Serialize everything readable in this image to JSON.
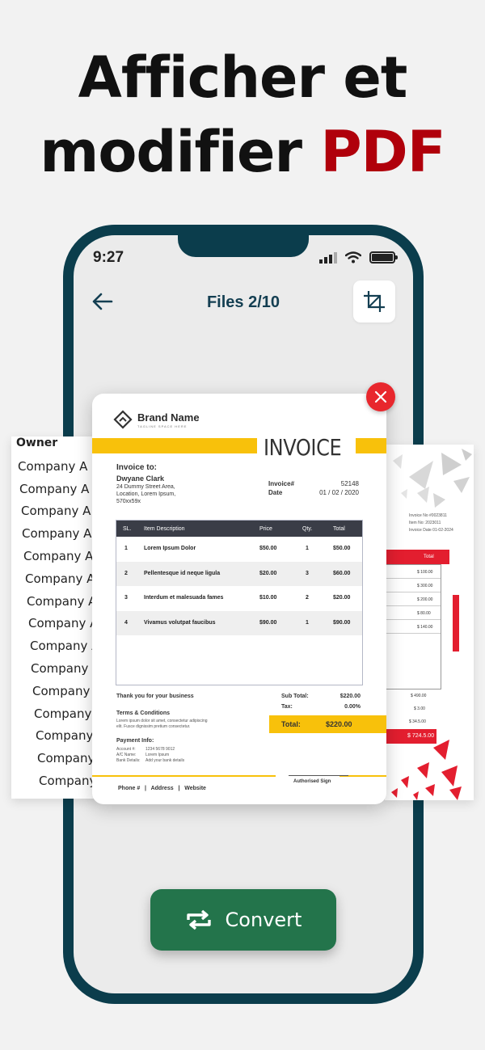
{
  "headline": {
    "line1": "Afficher et",
    "line2_prefix": "modifier ",
    "line2_accent": "PDF"
  },
  "status_bar": {
    "time": "9:27"
  },
  "nav": {
    "title": "Files 2/10"
  },
  "convert": {
    "label": "Convert"
  },
  "left_page": {
    "header": "Owner",
    "rows": [
      "Company A",
      "Company A",
      "Company A",
      "Company A",
      "Company A",
      "Company A",
      "Company A",
      "Company A",
      "Company A",
      "Company I",
      "Company",
      "Company",
      "Company",
      "Company",
      "Company"
    ]
  },
  "right_page": {
    "meta": [
      "Invoice No #0023811",
      "Item No: 2023011",
      "Invoice Date 01-02-2024"
    ],
    "header": "Total",
    "rows": [
      "$ 100.00",
      "$ 300.00",
      "$ 200.00",
      "$ 80.00",
      "$ 140.00"
    ],
    "totals": [
      "$ 490.00",
      "$ 3.00",
      "$ 34.5.00"
    ],
    "total": "$ 724.5.00"
  },
  "invoice": {
    "brand_name": "Brand Name",
    "tagline": "TAGLINE SPACE HERE",
    "title": "INVOICE",
    "to_label": "Invoice to:",
    "customer_name": "Dwyane Clark",
    "address": [
      "24 Dummy Street Area,",
      "Location, Lorem Ipsum,",
      "570xx59x"
    ],
    "invoice_no_label": "Invoice#",
    "invoice_no": "52148",
    "date_label": "Date",
    "date": "01 / 02 / 2020",
    "columns": [
      "SL.",
      "Item Description",
      "Price",
      "Qty.",
      "Total"
    ],
    "items": [
      {
        "sl": "1",
        "desc": "Lorem Ipsum Dolor",
        "price": "$50.00",
        "qty": "1",
        "total": "$50.00"
      },
      {
        "sl": "2",
        "desc": "Pellentesque id neque ligula",
        "price": "$20.00",
        "qty": "3",
        "total": "$60.00"
      },
      {
        "sl": "3",
        "desc": "Interdum et malesuada fames",
        "price": "$10.00",
        "qty": "2",
        "total": "$20.00"
      },
      {
        "sl": "4",
        "desc": "Vivamus volutpat faucibus",
        "price": "$90.00",
        "qty": "1",
        "total": "$90.00"
      }
    ],
    "thanks": "Thank you for your business",
    "terms_title": "Terms & Conditions",
    "terms_body": [
      "Lorem ipsum dolor sit amet, consectetur adipiscing",
      "elit. Fusce dignissim pretium consectetur."
    ],
    "payment_title": "Payment Info:",
    "payment": [
      {
        "label": "Account #:",
        "value": "1234 5678 9012"
      },
      {
        "label": "A/C Name:",
        "value": "Lorem Ipsum"
      },
      {
        "label": "Bank Details:",
        "value": "Add your bank details"
      }
    ],
    "subtotal_label": "Sub Total:",
    "subtotal": "$220.00",
    "tax_label": "Tax:",
    "tax": "0.00%",
    "total_label": "Total:",
    "total": "$220.00",
    "footer": "Phone #   |   Address   |   Website",
    "sign": "Authorised Sign"
  },
  "colors": {
    "accent": "#b0000b",
    "phone_frame": "#0b3d4c",
    "convert": "#23744b",
    "invoice_yellow": "#f8c10b",
    "close": "#e8272d"
  },
  "icons": {
    "back": "arrow-left-icon",
    "crop": "crop-icon",
    "close": "close-icon",
    "convert": "repeat-icon",
    "brand": "diamond-logo-icon"
  }
}
